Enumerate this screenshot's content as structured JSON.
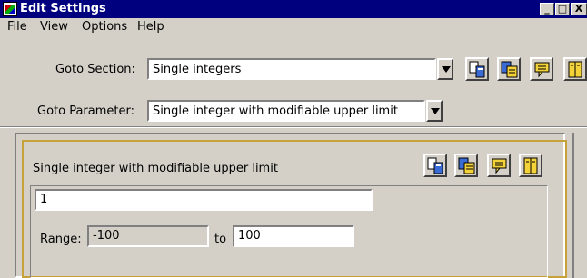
{
  "window": {
    "title": "Edit Settings",
    "minimize": "_",
    "restore": "□",
    "close": "X"
  },
  "menu": {
    "file": "File",
    "view": "View",
    "options": "Options",
    "help": "Help"
  },
  "goto_section": {
    "label": "Goto Section:",
    "value": "Single integers"
  },
  "goto_parameter": {
    "label": "Goto Parameter:",
    "value": "Single integer with modifiable upper limit"
  },
  "toolbar": {
    "icons": [
      "copy-icon",
      "paste-icon",
      "comment-icon",
      "book-icon"
    ]
  },
  "parameter": {
    "title": "Single integer with modifiable upper limit",
    "value": "1",
    "range_label": "Range:",
    "range_min": "-100",
    "to_label": "to",
    "range_max": "100"
  },
  "colors": {
    "titlebar": "#00007f",
    "panel_border": "#c7a13a",
    "background": "#d4d0c8"
  }
}
